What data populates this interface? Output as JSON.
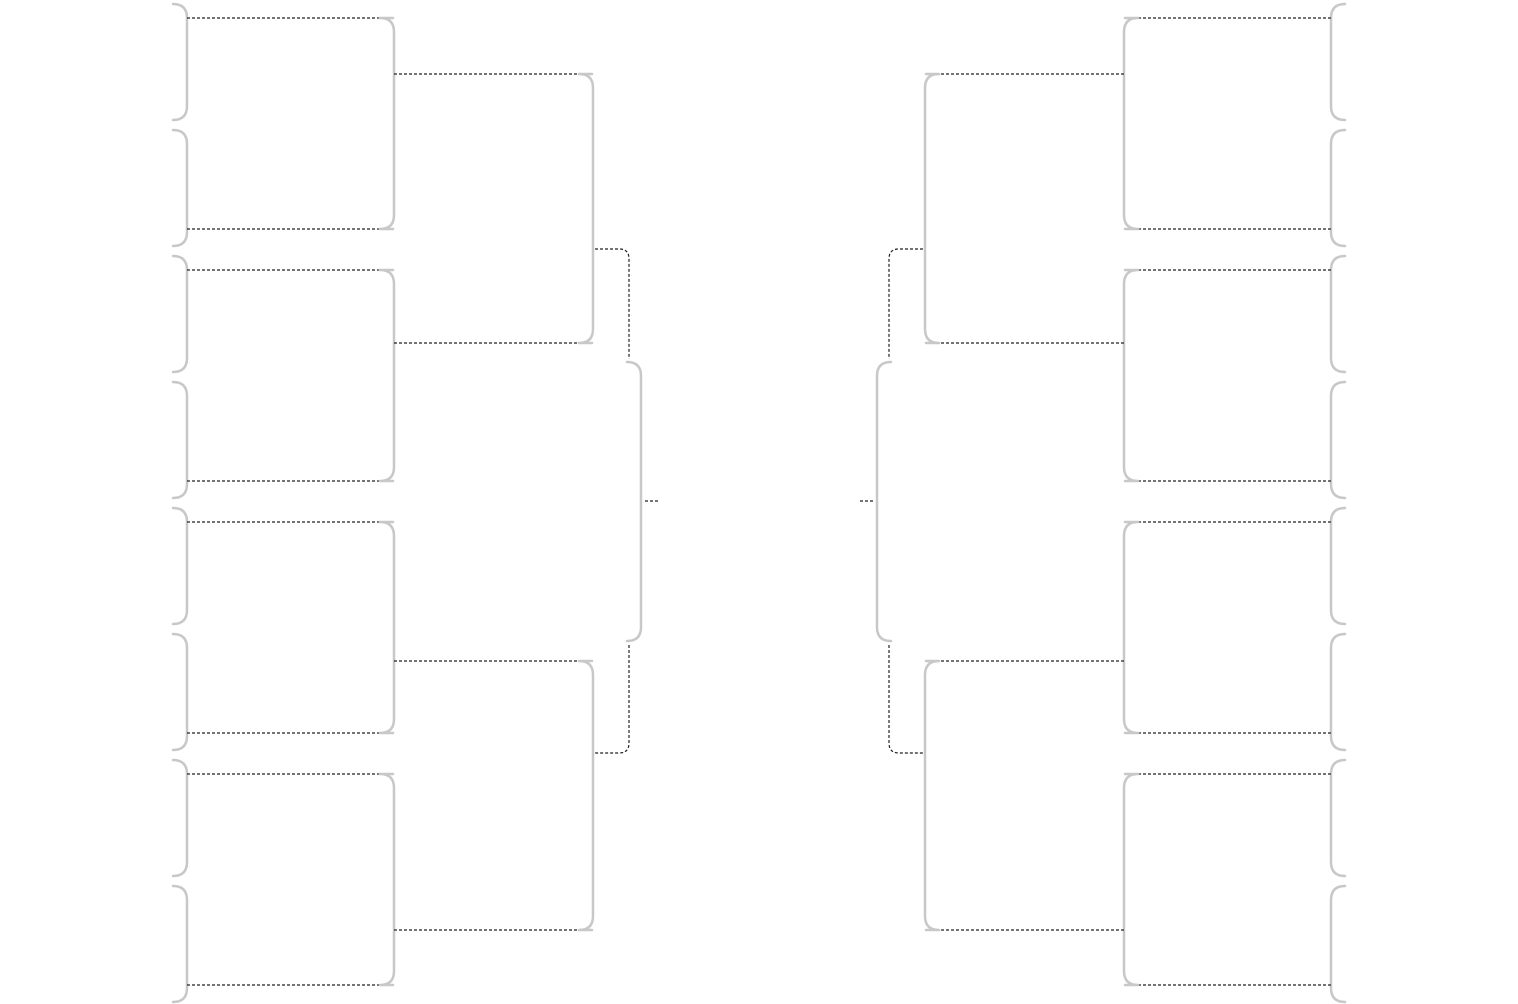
{
  "diagram": {
    "kind": "tournament-bracket",
    "teams_per_side": 8,
    "rounds_per_side": 3,
    "has_final_match": true,
    "has_labels": false,
    "colors": {
      "background": "#ffffff",
      "bracket_line": "#c8c8c8",
      "connector_line": "#222222"
    }
  }
}
